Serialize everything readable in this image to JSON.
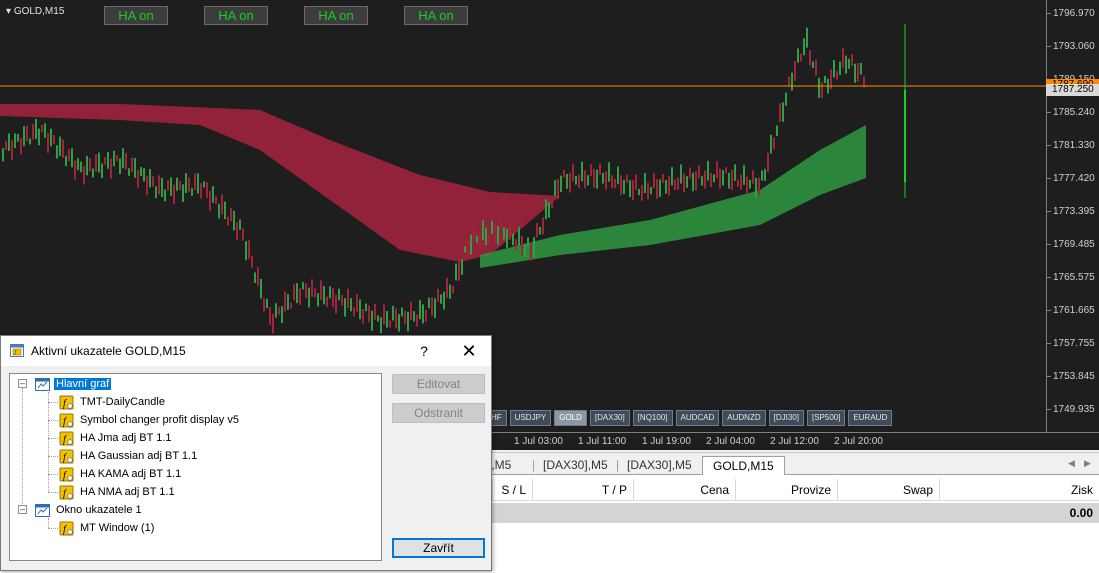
{
  "chart": {
    "symbol": "GOLD,M15",
    "ha_buttons": [
      "HA on",
      "HA on",
      "HA on",
      "HA on"
    ],
    "price_axis": [
      "1796.970",
      "1793.060",
      "1789.150",
      "1785.240",
      "1781.330",
      "1777.420",
      "1773.395",
      "1769.485",
      "1765.575",
      "1761.665",
      "1757.755",
      "1753.845",
      "1749.935"
    ],
    "ask_price": "1787.690",
    "bid_price": "1787.250",
    "sub_axis_top": "10",
    "sub_axis_bottom": "20",
    "time_axis": [
      "1 Jul 03:00",
      "1 Jul 11:00",
      "1 Jul 19:00",
      "2 Jul 04:00",
      "2 Jul 12:00",
      "2 Jul 20:00"
    ],
    "symbol_buttons": [
      "HF",
      "USDJPY",
      "GOLD",
      "[DAX30]",
      "[NQ100]",
      "AUDCAD",
      "AUDNZD",
      "[DJI30]",
      "[SP500]",
      "EURAUD"
    ],
    "active_symbol": "GOLD",
    "colors": {
      "bull_bar": "#2ea043",
      "bear_bar": "#a3233e",
      "ha_text": "#19d01e",
      "ask_line": "#ff8c00"
    }
  },
  "tabs": {
    "items": [
      "],M5",
      "[DAX30],M5",
      "[DAX30],M5",
      "GOLD,M15"
    ],
    "active": "GOLD,M15"
  },
  "trade": {
    "columns": [
      "S / L",
      "T / P",
      "Cena",
      "Provize",
      "Swap",
      "Zisk"
    ],
    "total_profit": "0.00"
  },
  "dialog": {
    "title": "Aktivní ukazatele GOLD,M15",
    "help_label": "?",
    "close_label": "✕",
    "tree": {
      "main_window": "Hlavní graf",
      "main_indicators": [
        "TMT-DailyCandle",
        "Symbol changer profit display v5",
        "HA Jma adj BT 1.1",
        "HA Gaussian adj BT 1.1",
        "HA KAMA adj BT 1.1",
        "HA NMA adj BT 1.1"
      ],
      "sub_window": "Okno ukazatele 1",
      "sub_indicators": [
        "MT Window (1)"
      ]
    },
    "buttons": {
      "edit": "Editovat",
      "delete": "Odstranit",
      "close": "Zavřít"
    }
  }
}
